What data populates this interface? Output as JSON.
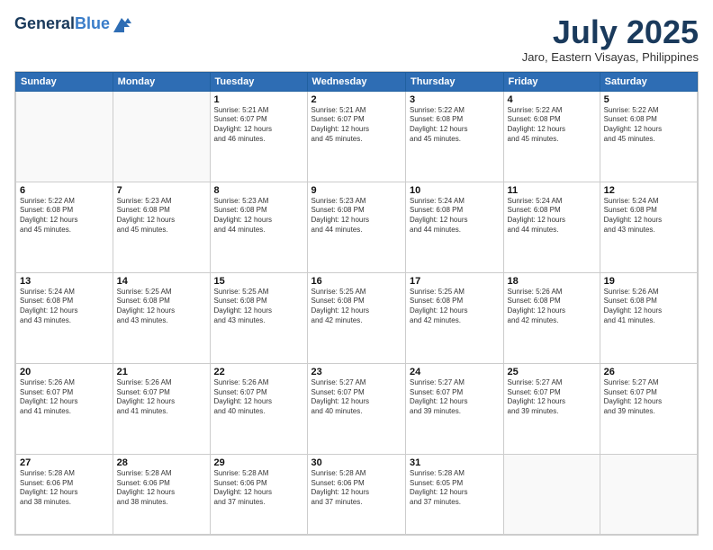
{
  "header": {
    "logo_line1": "General",
    "logo_line2": "Blue",
    "month": "July 2025",
    "location": "Jaro, Eastern Visayas, Philippines"
  },
  "days_of_week": [
    "Sunday",
    "Monday",
    "Tuesday",
    "Wednesday",
    "Thursday",
    "Friday",
    "Saturday"
  ],
  "weeks": [
    [
      {
        "day": "",
        "info": ""
      },
      {
        "day": "",
        "info": ""
      },
      {
        "day": "1",
        "info": "Sunrise: 5:21 AM\nSunset: 6:07 PM\nDaylight: 12 hours\nand 46 minutes."
      },
      {
        "day": "2",
        "info": "Sunrise: 5:21 AM\nSunset: 6:07 PM\nDaylight: 12 hours\nand 45 minutes."
      },
      {
        "day": "3",
        "info": "Sunrise: 5:22 AM\nSunset: 6:08 PM\nDaylight: 12 hours\nand 45 minutes."
      },
      {
        "day": "4",
        "info": "Sunrise: 5:22 AM\nSunset: 6:08 PM\nDaylight: 12 hours\nand 45 minutes."
      },
      {
        "day": "5",
        "info": "Sunrise: 5:22 AM\nSunset: 6:08 PM\nDaylight: 12 hours\nand 45 minutes."
      }
    ],
    [
      {
        "day": "6",
        "info": "Sunrise: 5:22 AM\nSunset: 6:08 PM\nDaylight: 12 hours\nand 45 minutes."
      },
      {
        "day": "7",
        "info": "Sunrise: 5:23 AM\nSunset: 6:08 PM\nDaylight: 12 hours\nand 45 minutes."
      },
      {
        "day": "8",
        "info": "Sunrise: 5:23 AM\nSunset: 6:08 PM\nDaylight: 12 hours\nand 44 minutes."
      },
      {
        "day": "9",
        "info": "Sunrise: 5:23 AM\nSunset: 6:08 PM\nDaylight: 12 hours\nand 44 minutes."
      },
      {
        "day": "10",
        "info": "Sunrise: 5:24 AM\nSunset: 6:08 PM\nDaylight: 12 hours\nand 44 minutes."
      },
      {
        "day": "11",
        "info": "Sunrise: 5:24 AM\nSunset: 6:08 PM\nDaylight: 12 hours\nand 44 minutes."
      },
      {
        "day": "12",
        "info": "Sunrise: 5:24 AM\nSunset: 6:08 PM\nDaylight: 12 hours\nand 43 minutes."
      }
    ],
    [
      {
        "day": "13",
        "info": "Sunrise: 5:24 AM\nSunset: 6:08 PM\nDaylight: 12 hours\nand 43 minutes."
      },
      {
        "day": "14",
        "info": "Sunrise: 5:25 AM\nSunset: 6:08 PM\nDaylight: 12 hours\nand 43 minutes."
      },
      {
        "day": "15",
        "info": "Sunrise: 5:25 AM\nSunset: 6:08 PM\nDaylight: 12 hours\nand 43 minutes."
      },
      {
        "day": "16",
        "info": "Sunrise: 5:25 AM\nSunset: 6:08 PM\nDaylight: 12 hours\nand 42 minutes."
      },
      {
        "day": "17",
        "info": "Sunrise: 5:25 AM\nSunset: 6:08 PM\nDaylight: 12 hours\nand 42 minutes."
      },
      {
        "day": "18",
        "info": "Sunrise: 5:26 AM\nSunset: 6:08 PM\nDaylight: 12 hours\nand 42 minutes."
      },
      {
        "day": "19",
        "info": "Sunrise: 5:26 AM\nSunset: 6:08 PM\nDaylight: 12 hours\nand 41 minutes."
      }
    ],
    [
      {
        "day": "20",
        "info": "Sunrise: 5:26 AM\nSunset: 6:07 PM\nDaylight: 12 hours\nand 41 minutes."
      },
      {
        "day": "21",
        "info": "Sunrise: 5:26 AM\nSunset: 6:07 PM\nDaylight: 12 hours\nand 41 minutes."
      },
      {
        "day": "22",
        "info": "Sunrise: 5:26 AM\nSunset: 6:07 PM\nDaylight: 12 hours\nand 40 minutes."
      },
      {
        "day": "23",
        "info": "Sunrise: 5:27 AM\nSunset: 6:07 PM\nDaylight: 12 hours\nand 40 minutes."
      },
      {
        "day": "24",
        "info": "Sunrise: 5:27 AM\nSunset: 6:07 PM\nDaylight: 12 hours\nand 39 minutes."
      },
      {
        "day": "25",
        "info": "Sunrise: 5:27 AM\nSunset: 6:07 PM\nDaylight: 12 hours\nand 39 minutes."
      },
      {
        "day": "26",
        "info": "Sunrise: 5:27 AM\nSunset: 6:07 PM\nDaylight: 12 hours\nand 39 minutes."
      }
    ],
    [
      {
        "day": "27",
        "info": "Sunrise: 5:28 AM\nSunset: 6:06 PM\nDaylight: 12 hours\nand 38 minutes."
      },
      {
        "day": "28",
        "info": "Sunrise: 5:28 AM\nSunset: 6:06 PM\nDaylight: 12 hours\nand 38 minutes."
      },
      {
        "day": "29",
        "info": "Sunrise: 5:28 AM\nSunset: 6:06 PM\nDaylight: 12 hours\nand 37 minutes."
      },
      {
        "day": "30",
        "info": "Sunrise: 5:28 AM\nSunset: 6:06 PM\nDaylight: 12 hours\nand 37 minutes."
      },
      {
        "day": "31",
        "info": "Sunrise: 5:28 AM\nSunset: 6:05 PM\nDaylight: 12 hours\nand 37 minutes."
      },
      {
        "day": "",
        "info": ""
      },
      {
        "day": "",
        "info": ""
      }
    ]
  ]
}
